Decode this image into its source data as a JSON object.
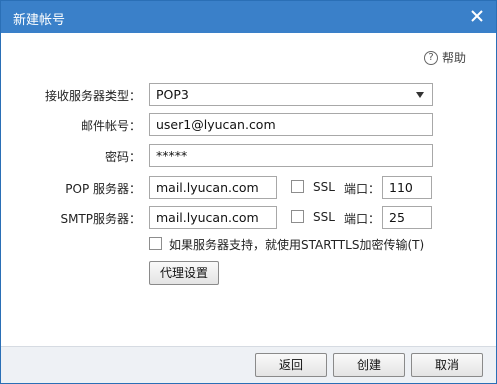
{
  "window": {
    "title": "新建帐号"
  },
  "help": {
    "label": "帮助"
  },
  "form": {
    "server_type_label": "接收服务器类型：",
    "server_type_value": "POP3",
    "account_label": "邮件帐号：",
    "account_value": "user1@lyucan.com",
    "password_label": "密码：",
    "password_value": "*****",
    "pop_label": "POP 服务器：",
    "pop_value": "mail.lyucan.com",
    "pop_ssl_label": "SSL",
    "pop_port_label": "端口：",
    "pop_port_value": "110",
    "smtp_label": "SMTP服务器：",
    "smtp_value": "mail.lyucan.com",
    "smtp_ssl_label": "SSL",
    "smtp_port_label": "端口：",
    "smtp_port_value": "25",
    "starttls_label": "如果服务器支持，就使用STARTTLS加密传输(T)",
    "proxy_button": "代理设置"
  },
  "footer": {
    "back_button": "返回",
    "create_button": "创建",
    "cancel_button": "取消"
  },
  "colors": {
    "titlebar": "#3a80c9",
    "footer": "#eef1f5"
  }
}
